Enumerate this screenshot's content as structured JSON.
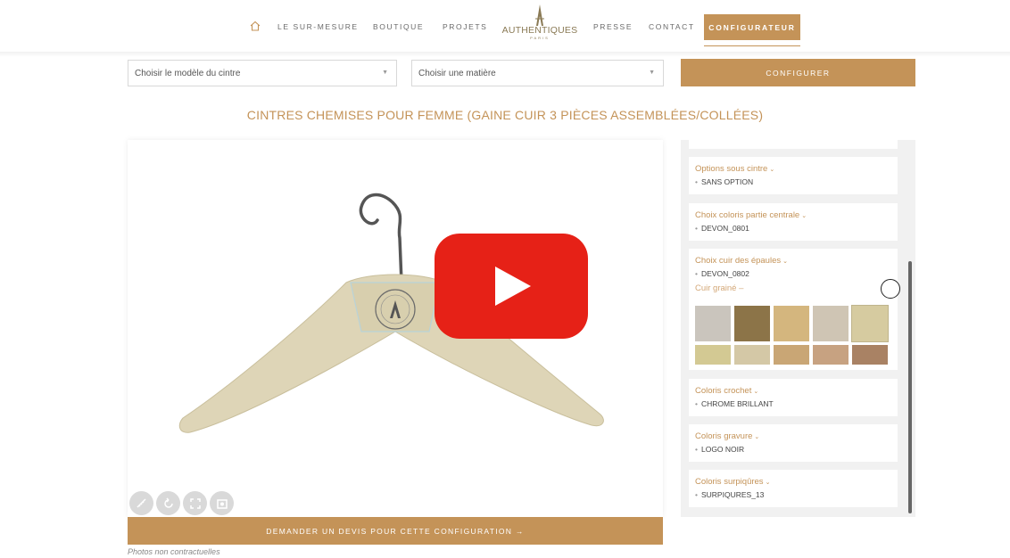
{
  "nav": {
    "links": [
      "LE SUR-MESURE",
      "BOUTIQUE",
      "PROJETS",
      "PRESSE",
      "CONTACT"
    ],
    "cta": "CONFIGURATEUR",
    "logo_text": "AUTHENTIQUES",
    "logo_sub": "PARIS"
  },
  "selectors": {
    "model_placeholder": "Choisir le modèle du cintre",
    "material_placeholder": "Choisir une matière",
    "configure_button": "CONFIGURER"
  },
  "title": "CINTRES CHEMISES POUR FEMME (GAINE CUIR 3 PIÈCES ASSEMBLÉES/COLLÉES)",
  "viewer": {
    "quote_button": "DEMANDER UN DEVIS POUR CETTE CONFIGURATION →",
    "disclaimer": "Photos non contractuelles",
    "tools": [
      "ruler-icon",
      "rotate-icon",
      "fullscreen-icon",
      "screenshot-icon"
    ]
  },
  "options": [
    {
      "title": "Options sous cintre",
      "value": "SANS OPTION"
    },
    {
      "title": "Choix coloris partie centrale",
      "value": "DEVON_0801"
    },
    {
      "title": "Choix cuir des épaules",
      "value": "DEVON_0802",
      "sub_title": "Cuir grainé"
    },
    {
      "title": "Coloris crochet",
      "value": "CHROME BRILLANT"
    },
    {
      "title": "Coloris gravure",
      "value": "LOGO NOIR"
    },
    {
      "title": "Coloris surpiqûres",
      "value": "SURPIQURES_13"
    }
  ],
  "swatch_colors": [
    "#cac5bd",
    "#8c7448",
    "#d4b67e",
    "#cfc5b4",
    "#d6cba0",
    "#d3c993",
    "#d4c8a6",
    "#c9a675",
    "#c7a281",
    "#a98264"
  ],
  "colors": {
    "accent": "#c49358",
    "youtube_red": "#e62117"
  }
}
